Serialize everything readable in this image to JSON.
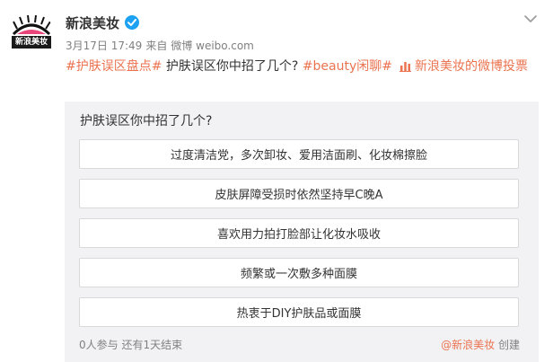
{
  "post": {
    "author": "新浪美妆",
    "avatar_text": "新浪美妆",
    "date": "3月17日 17:49",
    "source_prefix": "来自",
    "source": "微博 weibo.com",
    "tag1": "#护肤误区盘点#",
    "body": " 护肤误区你中招了几个? ",
    "tag2": "#beauty闲聊#",
    "poll_link": "新浪美妆的微博投票"
  },
  "poll": {
    "title": "护肤误区你中招了几个?",
    "options": [
      "过度清洁党，多次卸妆、爱用洁面刷、化妆棉擦脸",
      "皮肤屏障受损时依然坚持早C晚A",
      "喜欢用力拍打脸部让化妆水吸收",
      "频繁或一次敷多种面膜",
      "热衷于DIY护肤品或面膜"
    ],
    "participants": "0人参与",
    "remaining": "还有1天结束",
    "creator": "@新浪美妆",
    "created_label": "创建"
  },
  "colors": {
    "accent": "#eb7350",
    "verified": "#1da1f2",
    "card_bg": "#f2f2f5"
  },
  "icons": [
    "verified-icon",
    "chevron-down-icon",
    "poll-icon"
  ]
}
